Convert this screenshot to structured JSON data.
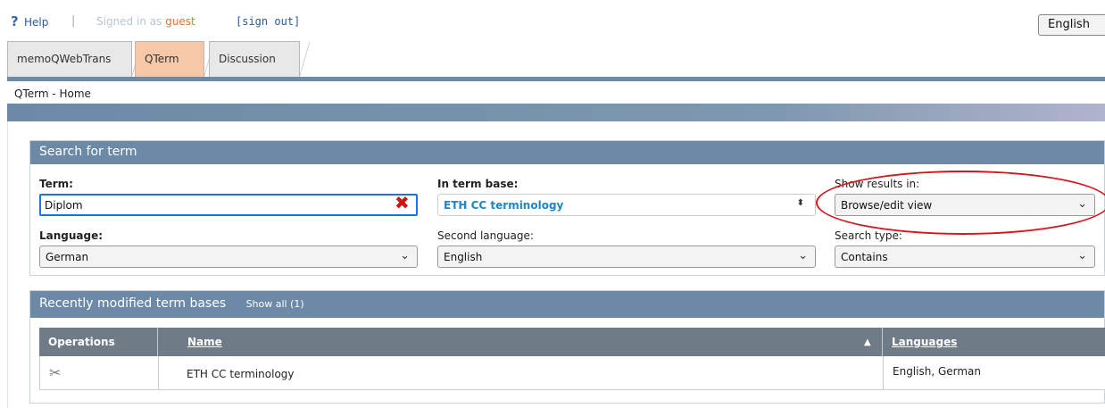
{
  "top": {
    "help_icon": "question-mark-icon",
    "help_label": "Help",
    "separator": "|",
    "signed_in_prefix": "Signed in as",
    "username": "guest",
    "sign_out": "[sign out]",
    "language": "English"
  },
  "tabs": [
    {
      "label": "memoQWebTrans",
      "active": false
    },
    {
      "label": "QTerm",
      "active": true
    },
    {
      "label": "Discussion",
      "active": false
    }
  ],
  "breadcrumb": "QTerm - Home",
  "search": {
    "title": "Search for term",
    "term_label": "Term:",
    "term_value": "Diplom",
    "clear_icon": "clear-x-icon",
    "termbase_label": "In term base:",
    "termbase_value": "ETH CC terminology",
    "show_results_label": "Show results in:",
    "show_results_value": "Browse/edit view",
    "language_label": "Language:",
    "language_value": "German",
    "second_language_label": "Second language:",
    "second_language_value": "English",
    "search_type_label": "Search type:",
    "search_type_value": "Contains"
  },
  "recent": {
    "title": "Recently modified term bases",
    "show_all": "Show all (1)",
    "columns": [
      "Operations",
      "Name",
      "Languages"
    ],
    "sort_indicator": "▲",
    "rows": [
      {
        "operations_icon": "tools-icon",
        "name": "ETH CC terminology",
        "languages": "English, German"
      }
    ]
  },
  "colors": {
    "header_blue": "#6c8aa6",
    "active_tab": "#f7c8a8",
    "accent_link": "#1f86c8",
    "highlight_circle": "#d9141c"
  }
}
